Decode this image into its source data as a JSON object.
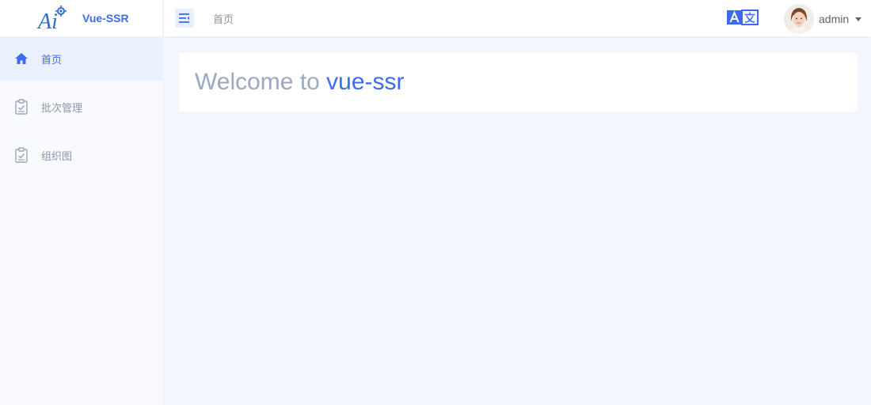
{
  "app": {
    "title": "Vue-SSR",
    "logo_text": "Ai"
  },
  "sidebar": {
    "items": [
      {
        "label": "首页",
        "icon": "home-icon",
        "active": true
      },
      {
        "label": "批次管理",
        "icon": "clipboard-check-icon",
        "active": false
      },
      {
        "label": "组织图",
        "icon": "clipboard-check-icon",
        "active": false
      }
    ]
  },
  "header": {
    "breadcrumb": "首页",
    "language_icon": "translate-icon",
    "user": {
      "name": "admin"
    }
  },
  "main": {
    "welcome_prefix": "Welcome to ",
    "welcome_brand": "vue-ssr"
  },
  "colors": {
    "accent": "#3b6cf0",
    "muted_text": "#9aa8c2",
    "page_background": "#f3f6fd",
    "sidebar_background": "#f8faff",
    "active_item_background": "#ebf0fe"
  }
}
